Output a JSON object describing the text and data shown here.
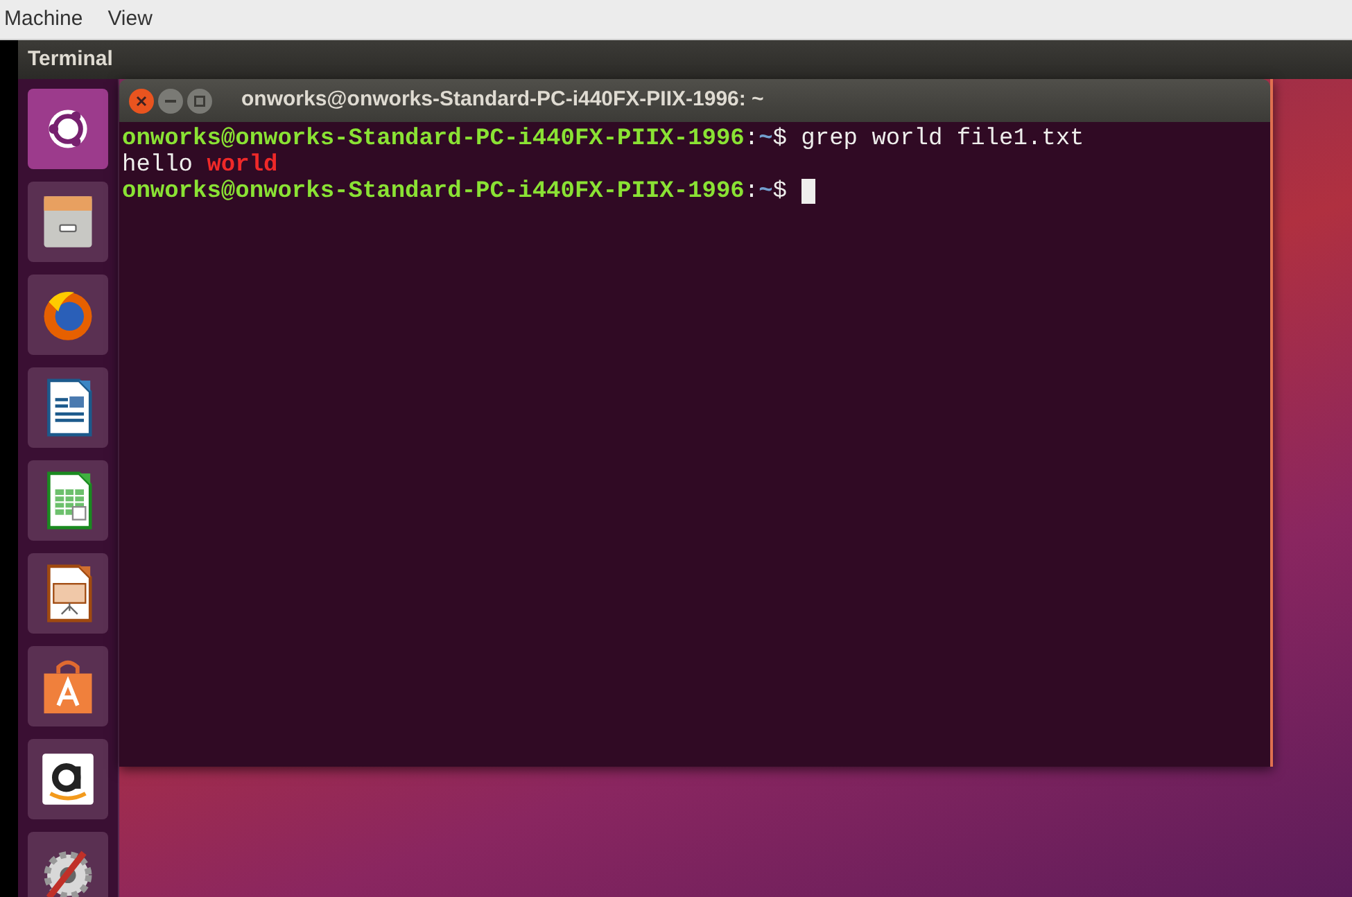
{
  "menu_bar": {
    "items": [
      "Machine",
      "View"
    ]
  },
  "top_panel": {
    "title": "Terminal"
  },
  "launcher": {
    "items": [
      {
        "kind": "dash"
      },
      {
        "kind": "files"
      },
      {
        "kind": "browser"
      },
      {
        "kind": "writer"
      },
      {
        "kind": "calc"
      },
      {
        "kind": "impress"
      },
      {
        "kind": "software"
      },
      {
        "kind": "amazon"
      },
      {
        "kind": "settings"
      }
    ]
  },
  "terminal": {
    "title": "onworks@onworks-Standard-PC-i440FX-PIIX-1996: ~",
    "lines": [
      {
        "kind": "prompt",
        "user_host": "onworks@onworks-Standard-PC-i440FX-PIIX-1996",
        "separator": ":",
        "path": "~",
        "command": "$ grep world file1.txt"
      },
      {
        "kind": "output",
        "segments": [
          {
            "text": "hello",
            "match": false
          },
          {
            "text": "world",
            "match": true
          }
        ]
      },
      {
        "kind": "prompt",
        "user_host": "onworks@onworks-Standard-PC-i440FX-PIIX-1996",
        "separator": ":",
        "path": "~",
        "command": "$",
        "cursor": true
      }
    ]
  }
}
